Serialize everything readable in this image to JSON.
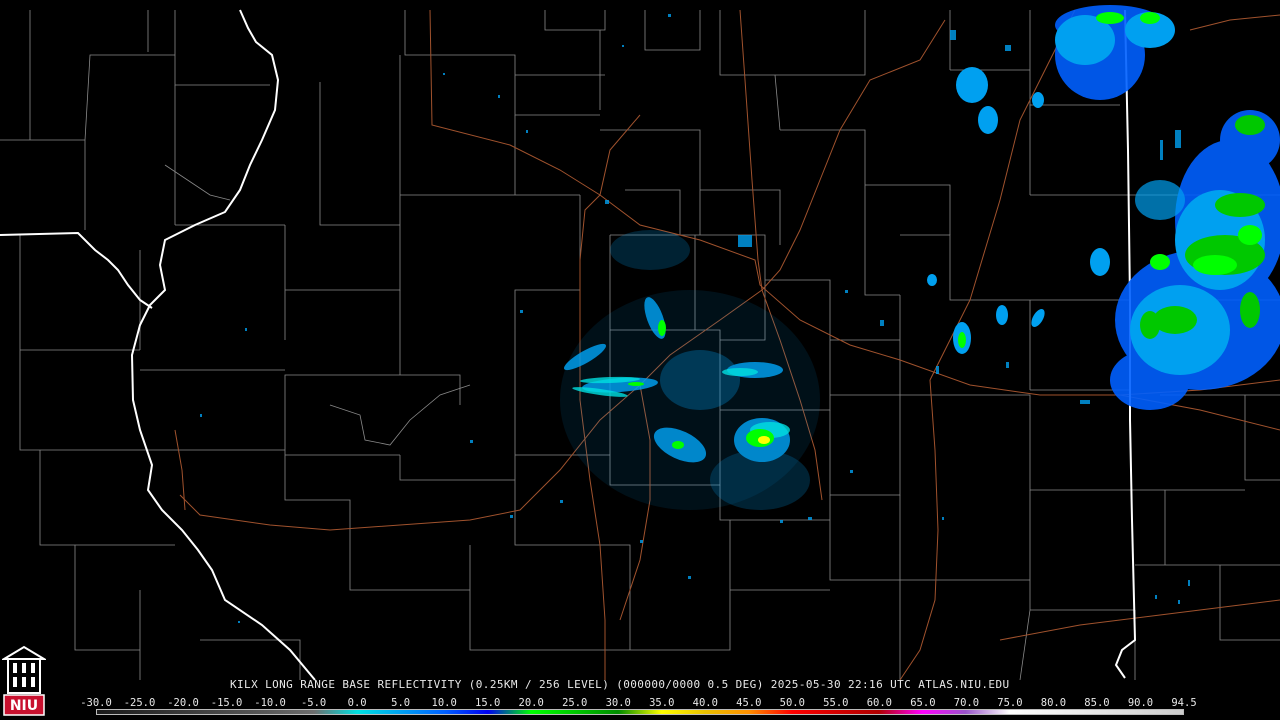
{
  "title": "KILX LONG RANGE BASE REFLECTIVITY (0.25KM / 256 LEVEL) (000000/0000 0.5 DEG) 2025-05-30 22:16 UTC  ATLAS.NIU.EDU",
  "logo_text": "NIU",
  "colors": {
    "background": "#000000",
    "state_lines": "#ffffff",
    "county_lines": "#8a8a8a",
    "roads": "#a0522d",
    "logo_red": "#c8102e"
  },
  "scale": {
    "labels": [
      "-30.0",
      "-25.0",
      "-20.0",
      "-15.0",
      "-10.0",
      "-5.0",
      "0.0",
      "5.0",
      "10.0",
      "15.0",
      "20.0",
      "25.0",
      "30.0",
      "35.0",
      "40.0",
      "45.0",
      "50.0",
      "55.0",
      "60.0",
      "65.0",
      "70.0",
      "75.0",
      "80.0",
      "85.0",
      "90.0",
      "94.5"
    ],
    "colors": [
      "#1a1a1a",
      "#2a2a2a",
      "#3a3a3a",
      "#4a4a4a",
      "#5a5a5a",
      "#6e6e6e",
      "#00e0e0",
      "#00a0f0",
      "#0060ff",
      "#0000f0",
      "#00ff00",
      "#00c800",
      "#008c00",
      "#ffff00",
      "#e8c000",
      "#ff9000",
      "#ff0000",
      "#d40000",
      "#b00000",
      "#ff00ff",
      "#9955c9",
      "#ffffff",
      "#f2f2f2",
      "#e6e6e6",
      "#dadada",
      "#cccccc"
    ]
  }
}
